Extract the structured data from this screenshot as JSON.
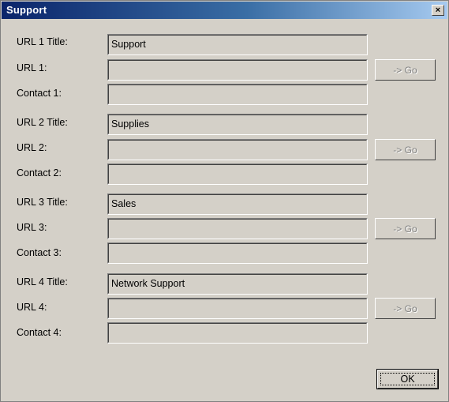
{
  "window": {
    "title": "Support",
    "close_label": "×"
  },
  "groups": [
    {
      "title_label": "URL 1 Title:",
      "title_value": "Support",
      "url_label": "URL 1:",
      "url_value": "",
      "contact_label": "Contact 1:",
      "contact_value": "",
      "go_label": "-> Go"
    },
    {
      "title_label": "URL 2 Title:",
      "title_value": "Supplies",
      "url_label": "URL 2:",
      "url_value": "",
      "contact_label": "Contact 2:",
      "contact_value": "",
      "go_label": "-> Go"
    },
    {
      "title_label": "URL 3 Title:",
      "title_value": "Sales",
      "url_label": "URL 3:",
      "url_value": "",
      "contact_label": "Contact 3:",
      "contact_value": "",
      "go_label": "-> Go"
    },
    {
      "title_label": "URL 4 Title:",
      "title_value": "Network Support",
      "url_label": "URL 4:",
      "url_value": "",
      "contact_label": "Contact 4:",
      "contact_value": "",
      "go_label": "-> Go"
    }
  ],
  "ok_label": "OK",
  "colors": {
    "dialog_bg": "#d4d0c8",
    "title_start": "#0a246a",
    "title_end": "#a6caf0",
    "disabled_text": "#808080"
  }
}
